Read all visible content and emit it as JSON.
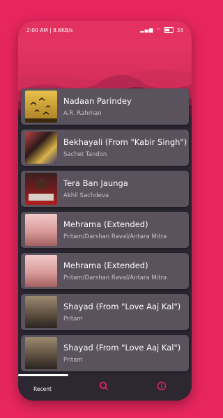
{
  "status": {
    "time_speed": "2:00 AM | 8.6KB/s",
    "battery_percent": "33"
  },
  "songs": [
    {
      "title": "Nadaan Parindey",
      "artist": "A.R. Rahman",
      "art_color": "#c9a13a"
    },
    {
      "title": "Bekhayali (From \"Kabir Singh\")",
      "artist": "Sachet Tandon",
      "art_color": "#8a2c2c"
    },
    {
      "title": "Tera Ban Jaunga",
      "artist": "Akhil Sachdeva",
      "art_color": "#6b1818"
    },
    {
      "title": "Mehrama (Extended)",
      "artist": "Pritam/Darshan Raval/Antara Mitra",
      "art_color": "#cf8a8a"
    },
    {
      "title": "Mehrama (Extended)",
      "artist": "Pritam/Darshan Raval/Antara Mitra",
      "art_color": "#cf8a8a"
    },
    {
      "title": "Shayad (From \"Love Aaj Kal\")",
      "artist": "Pritam",
      "art_color": "#6e6155"
    },
    {
      "title": "Shayad (From \"Love Aaj Kal\")",
      "artist": "Pritam",
      "art_color": "#6e6155"
    }
  ],
  "nav": {
    "recent_label": "Recent",
    "icons": [
      "search-icon",
      "info-icon"
    ]
  },
  "colors": {
    "accent": "#e8265e",
    "card": "#5a525d",
    "background": "#2a2530"
  }
}
